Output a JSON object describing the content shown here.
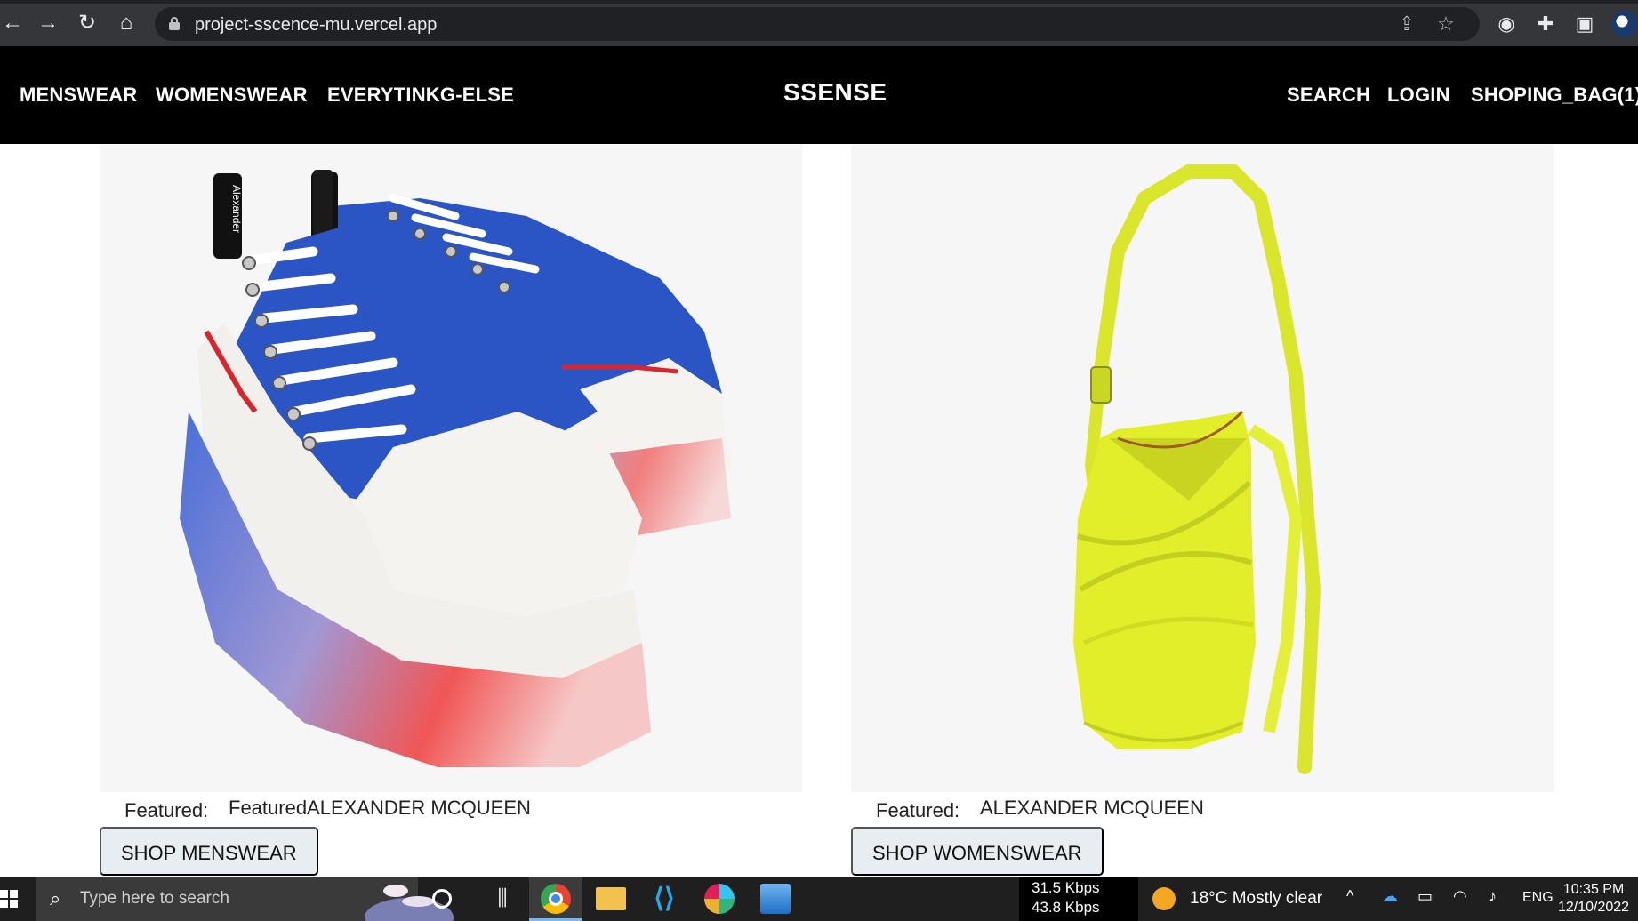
{
  "browser": {
    "url": "project-sscence-mu.vercel.app",
    "back_icon": "arrow-left-icon",
    "forward_icon": "arrow-right-icon",
    "reload_icon": "reload-icon",
    "home_icon": "home-icon"
  },
  "site": {
    "brand": "SSENSE",
    "nav_left": [
      "MENSWEAR",
      "WOMENSWEAR",
      "EVERYTINKG-ELSE"
    ],
    "nav_right": [
      "SEARCH",
      "LOGIN",
      "SHOPING_BAG(1)"
    ]
  },
  "products": [
    {
      "featured_label": "Featured:",
      "featured_brand": "FeaturedALEXANDER MCQUEEN",
      "button": "SHOP MENSWEAR",
      "image": "blue-white-sneakers-with-red-translucent-sole",
      "shoe_tongue_text": "Alexander"
    },
    {
      "featured_label": "Featured:",
      "featured_brand": "ALEXANDER MCQUEEN",
      "button": "SHOP WOMENSWEAR",
      "image": "lime-green-curved-bucket-bag"
    }
  ],
  "taskbar": {
    "search_placeholder": "Type here to search",
    "net_down": "31.5 Kbps",
    "net_up": "43.8 Kbps",
    "weather": "18°C  Mostly clear",
    "lang": "ENG",
    "time": "10:35 PM",
    "date": "12/10/2022"
  },
  "colors": {
    "header_bg": "#000000",
    "button_bg": "#e8edf2",
    "chrome_bg": "#35363a",
    "bag_color": "#e3ee2a",
    "shoe_blue": "#2b55c4"
  }
}
